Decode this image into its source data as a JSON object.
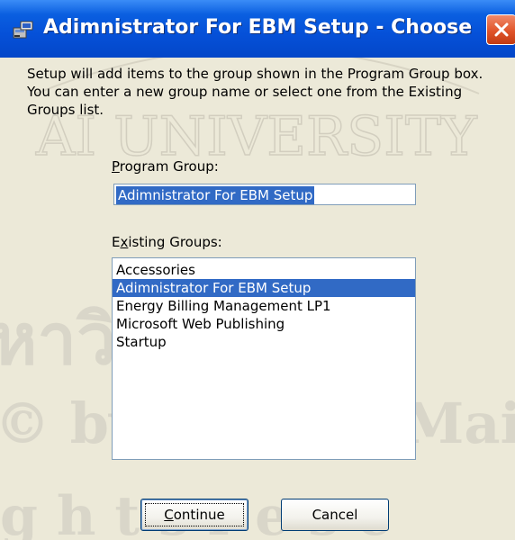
{
  "window": {
    "title": "Adimnistrator For EBM Setup - Choose Program ...",
    "icon": "setup-icon",
    "close_icon": "close-icon"
  },
  "description": "Setup will add items to the group shown in the Program Group box. You can enter a new group name or select one from the Existing Groups list.",
  "program_group": {
    "label": "Program Group:",
    "label_mnemonic": "P",
    "label_rest": "rogram Group:",
    "value": "Adimnistrator For EBM Setup"
  },
  "existing_groups": {
    "label_before": "E",
    "label_mnemonic": "x",
    "label_rest": "isting Groups:",
    "items": [
      "Accessories",
      "Adimnistrator For EBM Setup",
      "Energy Billing Management LP1",
      "Microsoft Web Publishing",
      "Startup"
    ],
    "selected_index": 1
  },
  "buttons": {
    "continue_mnemonic": "C",
    "continue_rest": "ontinue",
    "cancel": "Cancel"
  },
  "watermark": {
    "line1": "AI UNIVERSITY",
    "line2": "หาวิทยาลัยเชี",
    "line3": "© by Chiang Mai U",
    "line4": "g h t s   r e s e"
  },
  "colors": {
    "titlebar": "#0550d8",
    "selection": "#316ac5",
    "dialog_bg": "#ece9d8",
    "close_button": "#e0542a"
  }
}
